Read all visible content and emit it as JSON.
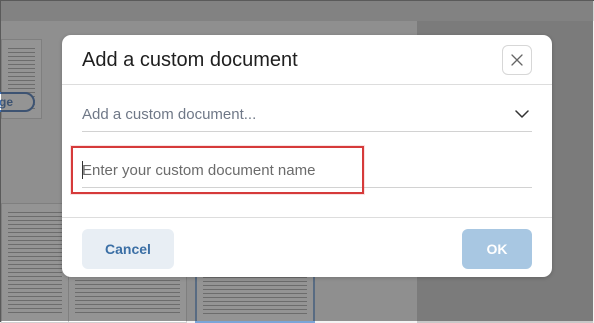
{
  "modal": {
    "title": "Add a custom document",
    "dropdown": {
      "selected_label": "Add a custom document..."
    },
    "custom_name_input": {
      "placeholder": "Enter your custom document name",
      "value": ""
    },
    "buttons": {
      "cancel": "Cancel",
      "ok": "OK"
    }
  },
  "background": {
    "pill_label": "ge"
  },
  "icons": {
    "close": "close-icon",
    "chevron": "chevron-down-icon"
  },
  "colors": {
    "highlight": "#d63a3a",
    "accent": "#3b6fa5",
    "ok_disabled": "#a8c7e2"
  }
}
